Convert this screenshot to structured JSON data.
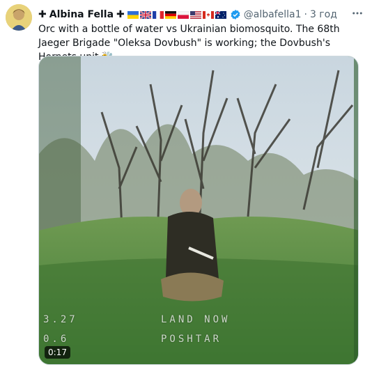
{
  "tweet": {
    "author_name": "Albina Fella",
    "name_prefix_symbol": "✚",
    "name_suffix_symbol": "✚",
    "flags": [
      "ukraine-flag",
      "uk-flag",
      "france-flag",
      "germany-flag",
      "poland-flag",
      "usa-flag",
      "canada-flag",
      "australia-flag"
    ],
    "verified_icon": "verified-badge-icon",
    "handle": "@albafella1",
    "separator": "·",
    "time": "3 год",
    "more_icon": "more-options-icon",
    "text": "Orc with a bottle of water vs Ukrainian biomosquito. The 68th Jaeger Brigade \"Oleksa Dovbush\" is working; the Dovbush's Hornets unit 🐝",
    "media": {
      "type": "video",
      "duration": "0:17",
      "osd_line1_left": "3.27",
      "osd_line1_right": "LAND NOW",
      "osd_line2_left": "0.6",
      "osd_line2_right": "POSHTAR"
    }
  },
  "colors": {
    "text_primary": "#0f1419",
    "text_secondary": "#536471",
    "verified": "#1d9bf0",
    "border": "#cfd9de"
  }
}
